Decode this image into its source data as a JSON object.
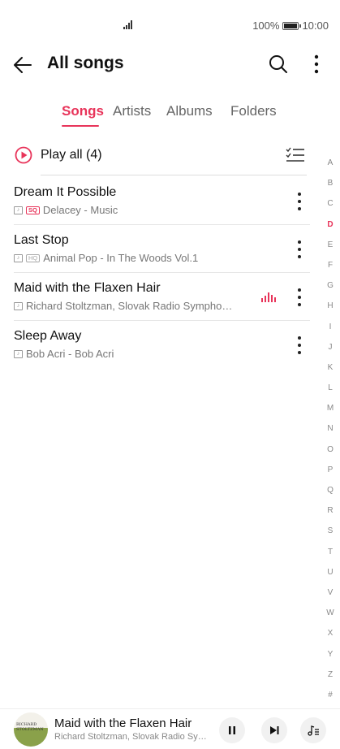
{
  "status_bar": {
    "battery": "100%",
    "time": "10:00",
    "battery_level": 1.0
  },
  "header": {
    "title": "All songs",
    "icons": {
      "back": "arrow-left-icon",
      "search": "search-icon",
      "more": "more-vertical-icon"
    }
  },
  "tabs": [
    {
      "label": "Songs",
      "active": true
    },
    {
      "label": "Artists",
      "active": false
    },
    {
      "label": "Albums",
      "active": false
    },
    {
      "label": "Folders",
      "active": false
    }
  ],
  "play_all": {
    "label": "Play all (4)",
    "icons": {
      "play": "play-circle-icon",
      "multiselect": "multiselect-icon"
    }
  },
  "songs": [
    {
      "title": "Dream It Possible",
      "badge": "SQ",
      "subtitle": "Delacey - Music",
      "playing": false
    },
    {
      "title": "Last Stop",
      "badge": "HQ",
      "subtitle": "Animal Pop - In The Woods Vol.1",
      "playing": false
    },
    {
      "title": "Maid with the Flaxen Hair",
      "badge": "",
      "subtitle": "Richard Stoltzman, Slovak Radio Sympho…",
      "playing": true
    },
    {
      "title": "Sleep Away",
      "badge": "",
      "subtitle": "Bob Acri - Bob Acri",
      "playing": false
    }
  ],
  "alpha_index": {
    "letters": [
      "A",
      "B",
      "C",
      "D",
      "E",
      "F",
      "G",
      "H",
      "I",
      "J",
      "K",
      "L",
      "M",
      "N",
      "O",
      "P",
      "Q",
      "R",
      "S",
      "T",
      "U",
      "V",
      "W",
      "X",
      "Y",
      "Z",
      "#"
    ],
    "active": "D"
  },
  "mini_player": {
    "title": "Maid with the Flaxen Hair",
    "subtitle": "Richard Stoltzman, Slovak Radio Sym…",
    "album_art_text": "RICHARD STOLTZMAN",
    "icons": {
      "pause": "pause-icon",
      "next": "skip-next-icon",
      "queue": "playlist-icon"
    }
  },
  "colors": {
    "accent": "#e8345a",
    "text": "#111111",
    "secondary": "#777777"
  }
}
